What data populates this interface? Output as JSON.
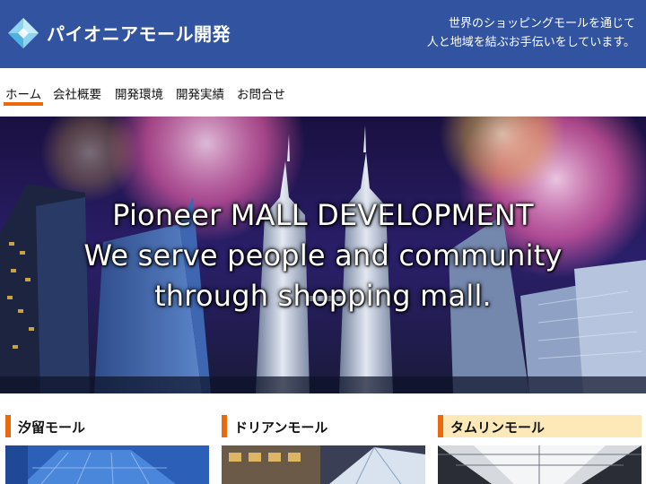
{
  "header": {
    "title": "パイオニアモール開発",
    "tagline_line1": "世界のショッピングモールを通じて",
    "tagline_line2": "人と地域を結ぶお手伝いをしています。",
    "logo_icon": "diamond-logo-icon",
    "background": "#3254a0"
  },
  "nav": {
    "items": [
      {
        "label": "ホーム",
        "active": true
      },
      {
        "label": "会社概要",
        "active": false
      },
      {
        "label": "開発環境",
        "active": false
      },
      {
        "label": "開発実績",
        "active": false
      },
      {
        "label": "お問合せ",
        "active": false
      }
    ],
    "accent": "#ea6a0d"
  },
  "hero": {
    "line1": "Pioneer MALL DEVELOPMENT",
    "line2": "We serve people and community",
    "line3": "through shopping mall."
  },
  "cards": [
    {
      "title": "汐留モール"
    },
    {
      "title": "ドリアンモール"
    },
    {
      "title": "タムリンモール"
    }
  ]
}
